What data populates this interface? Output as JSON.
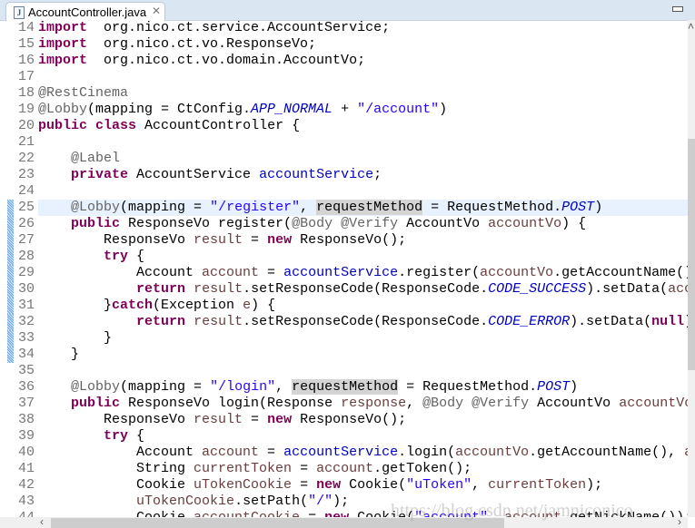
{
  "tab": {
    "label": "AccountController.java",
    "icon": "java-file-icon",
    "close_icon": "close-icon"
  },
  "colors": {
    "keyword": "#7f0055",
    "annotation": "#646464",
    "string": "#2a00ff",
    "field": "#0000c0",
    "local_variable": "#6a3e3e",
    "current_line": "#e8f2fe",
    "occurrence": "#d4d4d4"
  },
  "current_line": 25,
  "changed_lines": [
    25,
    26,
    27,
    28,
    29,
    30,
    31,
    32,
    33,
    34
  ],
  "watermark": "https://blog.csdn.net/jamniconico",
  "lines": [
    {
      "n": "14",
      "t": [
        [
          "k",
          "import"
        ],
        [
          "",
          "  org.nico.ct.service.AccountService;"
        ]
      ]
    },
    {
      "n": "15",
      "t": [
        [
          "k",
          "import"
        ],
        [
          "",
          "  org.nico.ct.vo.ResponseVo;"
        ]
      ]
    },
    {
      "n": "16",
      "t": [
        [
          "k",
          "import"
        ],
        [
          "",
          "  org.nico.ct.vo.domain.AccountVo;"
        ]
      ]
    },
    {
      "n": "17",
      "t": []
    },
    {
      "n": "18",
      "t": [
        [
          "a",
          "@RestCinema"
        ]
      ]
    },
    {
      "n": "19",
      "t": [
        [
          "a",
          "@Lobby"
        ],
        [
          "",
          "(mapping = CtConfig."
        ],
        [
          "i",
          "APP_NORMAL"
        ],
        [
          "",
          " + "
        ],
        [
          "s",
          "\"/account\""
        ],
        [
          "",
          ")"
        ]
      ]
    },
    {
      "n": "20",
      "t": [
        [
          "k",
          "public"
        ],
        [
          "",
          " "
        ],
        [
          "k",
          "class"
        ],
        [
          "",
          " AccountController {"
        ]
      ]
    },
    {
      "n": "21",
      "t": []
    },
    {
      "n": "22",
      "t": [
        [
          "",
          "    "
        ],
        [
          "a",
          "@Label"
        ]
      ]
    },
    {
      "n": "23",
      "t": [
        [
          "",
          "    "
        ],
        [
          "k",
          "private"
        ],
        [
          "",
          " AccountService "
        ],
        [
          "f",
          "accountService"
        ],
        [
          "",
          ";"
        ]
      ]
    },
    {
      "n": "24",
      "t": []
    },
    {
      "n": "25",
      "t": [
        [
          "",
          "    "
        ],
        [
          "a",
          "@Lobby"
        ],
        [
          "",
          "(mapping = "
        ],
        [
          "s",
          "\"/register\""
        ],
        [
          "",
          ", "
        ],
        [
          "h",
          "requestMethod"
        ],
        [
          "",
          " = RequestMethod."
        ],
        [
          "i",
          "POST"
        ],
        [
          "",
          ")"
        ]
      ]
    },
    {
      "n": "26",
      "t": [
        [
          "",
          "    "
        ],
        [
          "k",
          "public"
        ],
        [
          "",
          " ResponseVo register("
        ],
        [
          "a",
          "@Body"
        ],
        [
          "",
          " "
        ],
        [
          "a",
          "@Verify"
        ],
        [
          "",
          " AccountVo "
        ],
        [
          "v",
          "accountVo"
        ],
        [
          "",
          ") {"
        ]
      ]
    },
    {
      "n": "27",
      "t": [
        [
          "",
          "        ResponseVo "
        ],
        [
          "v",
          "result"
        ],
        [
          "",
          " = "
        ],
        [
          "k",
          "new"
        ],
        [
          "",
          " ResponseVo();"
        ]
      ]
    },
    {
      "n": "28",
      "t": [
        [
          "",
          "        "
        ],
        [
          "k",
          "try"
        ],
        [
          "",
          " {"
        ]
      ]
    },
    {
      "n": "29",
      "t": [
        [
          "",
          "            Account "
        ],
        [
          "v",
          "account"
        ],
        [
          "",
          " = "
        ],
        [
          "f",
          "accountService"
        ],
        [
          "",
          ".register("
        ],
        [
          "v",
          "accountVo"
        ],
        [
          "",
          ".getAccountName()"
        ]
      ]
    },
    {
      "n": "30",
      "t": [
        [
          "",
          "            "
        ],
        [
          "k",
          "return"
        ],
        [
          "",
          " "
        ],
        [
          "v",
          "result"
        ],
        [
          "",
          ".setResponseCode(ResponseCode."
        ],
        [
          "i",
          "CODE_SUCCESS"
        ],
        [
          "",
          ").setData("
        ],
        [
          "v",
          "acc"
        ]
      ]
    },
    {
      "n": "31",
      "t": [
        [
          "",
          "        }"
        ],
        [
          "k",
          "catch"
        ],
        [
          "",
          "(Exception "
        ],
        [
          "v",
          "e"
        ],
        [
          "",
          ") {"
        ]
      ]
    },
    {
      "n": "32",
      "t": [
        [
          "",
          "            "
        ],
        [
          "k",
          "return"
        ],
        [
          "",
          " "
        ],
        [
          "v",
          "result"
        ],
        [
          "",
          ".setResponseCode(ResponseCode."
        ],
        [
          "i",
          "CODE_ERROR"
        ],
        [
          "",
          ").setData("
        ],
        [
          "k",
          "null"
        ],
        [
          "",
          ")"
        ]
      ]
    },
    {
      "n": "33",
      "t": [
        [
          "",
          "        }"
        ]
      ]
    },
    {
      "n": "34",
      "t": [
        [
          "",
          "    }"
        ]
      ]
    },
    {
      "n": "35",
      "t": []
    },
    {
      "n": "36",
      "t": [
        [
          "",
          "    "
        ],
        [
          "a",
          "@Lobby"
        ],
        [
          "",
          "(mapping = "
        ],
        [
          "s",
          "\"/login\""
        ],
        [
          "",
          ", "
        ],
        [
          "h",
          "requestMethod"
        ],
        [
          "",
          " = RequestMethod."
        ],
        [
          "i",
          "POST"
        ],
        [
          "",
          ")"
        ]
      ]
    },
    {
      "n": "37",
      "t": [
        [
          "",
          "    "
        ],
        [
          "k",
          "public"
        ],
        [
          "",
          " ResponseVo login(Response "
        ],
        [
          "v",
          "response"
        ],
        [
          "",
          ", "
        ],
        [
          "a",
          "@Body"
        ],
        [
          "",
          " "
        ],
        [
          "a",
          "@Verify"
        ],
        [
          "",
          " AccountVo "
        ],
        [
          "v",
          "accountVo"
        ]
      ]
    },
    {
      "n": "38",
      "t": [
        [
          "",
          "        ResponseVo "
        ],
        [
          "v",
          "result"
        ],
        [
          "",
          " = "
        ],
        [
          "k",
          "new"
        ],
        [
          "",
          " ResponseVo();"
        ]
      ]
    },
    {
      "n": "39",
      "t": [
        [
          "",
          "        "
        ],
        [
          "k",
          "try"
        ],
        [
          "",
          " {"
        ]
      ]
    },
    {
      "n": "40",
      "t": [
        [
          "",
          "            Account "
        ],
        [
          "v",
          "account"
        ],
        [
          "",
          " = "
        ],
        [
          "f",
          "accountService"
        ],
        [
          "",
          ".login("
        ],
        [
          "v",
          "accountVo"
        ],
        [
          "",
          ".getAccountName(), "
        ],
        [
          "v",
          "a"
        ]
      ]
    },
    {
      "n": "41",
      "t": [
        [
          "",
          "            String "
        ],
        [
          "v",
          "currentToken"
        ],
        [
          "",
          " = "
        ],
        [
          "v",
          "account"
        ],
        [
          "",
          ".getToken();"
        ]
      ]
    },
    {
      "n": "42",
      "t": [
        [
          "",
          "            Cookie "
        ],
        [
          "v",
          "uTokenCookie"
        ],
        [
          "",
          " = "
        ],
        [
          "k",
          "new"
        ],
        [
          "",
          " Cookie("
        ],
        [
          "s",
          "\"uToken\""
        ],
        [
          "",
          ", "
        ],
        [
          "v",
          "currentToken"
        ],
        [
          "",
          ");"
        ]
      ]
    },
    {
      "n": "43",
      "t": [
        [
          "",
          "            "
        ],
        [
          "v",
          "uTokenCookie"
        ],
        [
          "",
          ".setPath("
        ],
        [
          "s",
          "\"/\""
        ],
        [
          "",
          ");"
        ]
      ]
    },
    {
      "n": "44",
      "t": [
        [
          "",
          "            Cookie "
        ],
        [
          "v",
          "accountCookie"
        ],
        [
          "",
          " = "
        ],
        [
          "k",
          "new"
        ],
        [
          "",
          " Cookie("
        ],
        [
          "s",
          "\"account\""
        ],
        [
          "",
          ", "
        ],
        [
          "v",
          "account"
        ],
        [
          "",
          ".getNickName());"
        ]
      ]
    }
  ]
}
